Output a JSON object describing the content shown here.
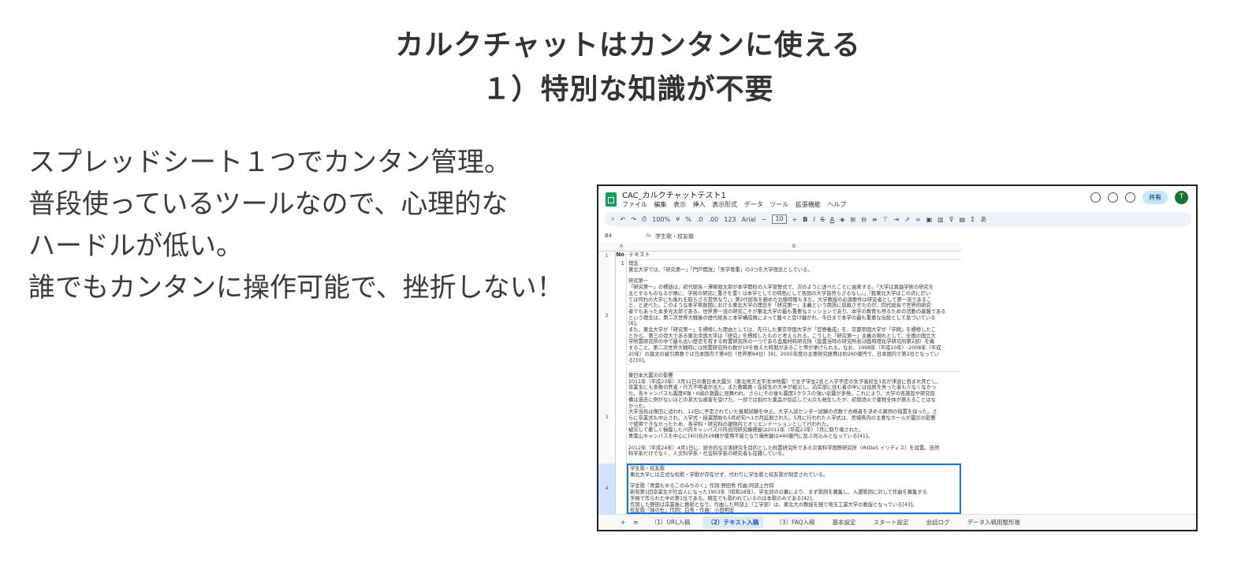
{
  "heading": {
    "line1": "カルクチャットはカンタンに使える",
    "line2": "１）特別な知識が不要"
  },
  "body_lines": [
    "スプレッドシート１つでカンタン管理。",
    "普段使っているツールなので、心理的な",
    "ハードルが低い。",
    "誰でもカンタンに操作可能で、挫折しない！"
  ],
  "sheet": {
    "doc_title": "CAC_カルクチャットテスト1",
    "menus": [
      "ファイル",
      "編集",
      "表示",
      "挿入",
      "表示形式",
      "データ",
      "ツール",
      "拡張機能",
      "ヘルプ"
    ],
    "share_label": "共有",
    "avatar_letter": "T",
    "toolbar": {
      "zoom": "100%",
      "currency": "¥",
      "percent": "%",
      "dec_less": ".0",
      "dec_more": ".00",
      "format_123": "123",
      "font": "Arial",
      "font_size": "10"
    },
    "cell_ref": "B4",
    "formula_value": "学生歌・校友歌",
    "col_a": "A",
    "col_b": "B",
    "header_row": {
      "no": "No",
      "text": "テキスト"
    },
    "rows": [
      {
        "num": "1",
        "no": "",
        "text_lines": []
      },
      {
        "num": "2",
        "no": "1",
        "text_lines": [
          "理念",
          "東北大学では、「研究第一」「門戸開放」「実学尊重」の3つを大学理念としている。",
          "",
          "研究第一",
          "「研究第一」の標語は、初代総長・澤柳政太郎が本学開校の入学宣誓式で、次のように述べたことに由来する。「大学は真論学術の研究を",
          "主とするものなるが故に、学術の研究に重きを置くは本学としての特色にして各国の大学皆然らざるなし。」「我東北大学はこの点に於い",
          "ては何れの大学にも後れを取らざる覚悟なり。」第2代総長を務めた北條時敬もまた、大学教授の必須要件は研究者として第一流であるこ",
          "と、と述べた。このような本学草創期における東北大学の理念を「研究第一」主義という用語に収斂させたのが、同代総長で世界的研究",
          "者でもあった本多光太郎である。世界第一流の研究こそが東北大学の最も重要なミッションであり、本学の教育も然るための活動の基盤である",
          "という理念は、第二次世界大戦後の歴代総長と本学構成員によって脈々と受け継がれ、今日まで本学の最も重要な伝統として息づいている",
          "[6]。",
          "また、東北大学が「研究第一」を標榜した理由としては、先行した東京帝国大学が「官僚養成」を、京都帝国大学が「学問」を標榜したこ",
          "とから、第三の帝大である東北帝国大学は「研究」を標榜したものと考えられる。こうした「研究第一」主義の現れとして、全国の国立大",
          "学附置研究所の中で最も古い歴史を有する附置研究所の一つである金属材料研究所（設置当時の研究所名は臨時理化学研究所第2部）を擁",
          "すること、第二次世界大戦時には附置研究所の数が10を数えた時期があること等が挙げられる。なお、1998年（平成10年）-2008年（平成",
          "20年）の論文の被引用数では日本国内で第4位（世界第64位）[9]、2005年度の主要研究経費は約260億円で、日本国内で第2位となってい",
          "る[10]。"
        ]
      },
      {
        "num": "3",
        "no": "",
        "text_lines": [
          "東日本大震災の影響",
          "2011年（平成23年）3月11日の東日本大震災（東北地方太平洋沖地震）で女子学生2名と入学予定の女子高校生1名が津波に呑まれ死亡し、",
          "卒業生にも多数の死者・行方不明者が出た。また教職員・在校生の大半が被災し、沿岸部に住む者の中には住居を失った者も少なくなかっ",
          "た。各キャンパスも震度6強・6弱の激震に見舞われ、さらにその後も震度5クラスの強い余震が多発。これにより、大学の各施設や研究設",
          "備は過去に例がないほどの甚大な被害を受けた。一部では割れた薬品が反応して火災も発生したが、初期消火で建物全体が燃えることはな",
          "かった。",
          "大学当局は復旧に追われ、12日に予定されていた後期試験を中止。大学入試センター試験の点数で合格者を決める異例の措置を採った。さ",
          "らに卒業式も中止され、入学式・授業開始も5月初旬へ1カ月延期された。5月に行われた入学式は、宮城県内の主要なホールが震災の影響",
          "で使用できなかったため、各学科・研究科の建物内でオリエンテーションとして行われた。",
          "被災して著しく損傷した川内キャンパス川内合同研究棟標屋は2011年（平成23年）7月に取り壊された。",
          "青葉山キャンパスを中心に[40]合計28棟が使用不能となり損失額は440億円に及ぶ見込みとなっている[41]。",
          "",
          "2012年（平成24年）4月1日に、総合的な災害研究を目的とした附置研究所である災害科学国際研究所（IRIDeS イリディス）を設置。自然",
          "科学系だけでなく、人文科学系・社会科学系の研究者も在籍している。"
        ]
      },
      {
        "num": "4",
        "no": "",
        "text_lines": [
          "学生歌・校友歌",
          "東北大学には正式な校歌・学歌が存在せず、代わりに学生歌と校友歌が制定されている。",
          "",
          "学生歌『青葉もゆるこのみちのく』作詞:野田秀 作曲:阿部上竹四",
          "新制第1回卒業生が社会人になった1953年（昭和28年）、学生部の公募により、まず歌詞を募集し、入選歌詞に対して作曲を募集する",
          "手順で作られた中の第1位である。現在でも歌われているのは本歌のみである[42]。",
          "作詞した野田は卒業後に教師となり、作曲した阿部上（工学部）は、東北大の教授を経て埼玉工業大学の教授となっている[43]。",
          "校友歌『緑の杜』作詞：白秀・作曲：小田明宏"
        ]
      }
    ],
    "tabs": [
      {
        "label": "（1）URL入稿"
      },
      {
        "label": "（2）テキスト入稿"
      },
      {
        "label": "（3）FAQ入稿"
      },
      {
        "label": "基本設定"
      },
      {
        "label": "スタート設定"
      },
      {
        "label": "会話ログ"
      },
      {
        "label": "データ入稿用整形後"
      }
    ],
    "active_tab_index": 1,
    "accent_color": "#1a73e8",
    "share_color": "#c2e7ff",
    "logo_color": "#0f9d58"
  }
}
